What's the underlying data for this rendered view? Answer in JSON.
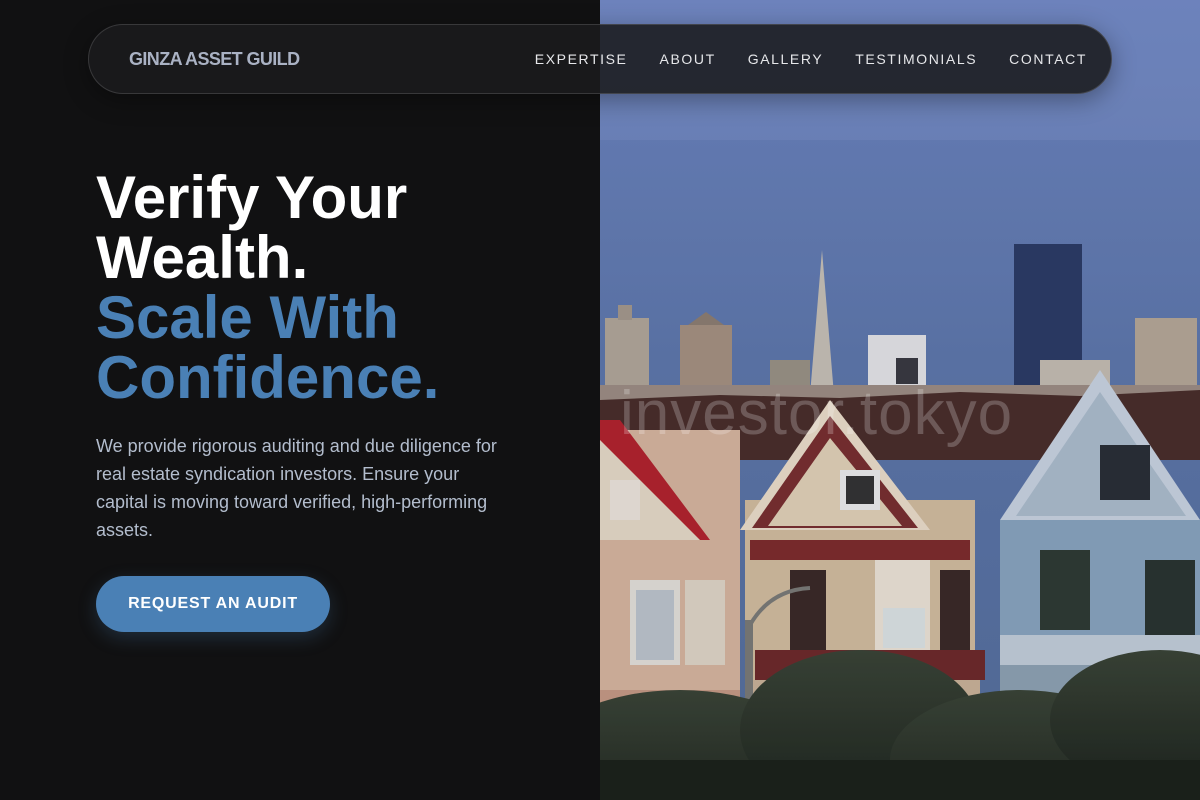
{
  "nav": {
    "brand": "GINZA ASSET GUILD",
    "links": [
      "EXPERTISE",
      "ABOUT",
      "GALLERY",
      "TESTIMONIALS",
      "CONTACT"
    ]
  },
  "hero": {
    "headline_line1": "Verify Your",
    "headline_line2": "Wealth.",
    "headline_accent1": "Scale With",
    "headline_accent2": "Confidence.",
    "description": "We provide rigorous auditing and due diligence for real estate syndication investors. Ensure your capital is moving toward verified, high-performing assets.",
    "cta_label": "REQUEST AN AUDIT"
  },
  "photo": {
    "watermark": "investor.tokyo"
  },
  "colors": {
    "background": "#111112",
    "accent": "#4a80b5",
    "text_primary": "#ffffff",
    "text_muted": "#b3bdcd"
  }
}
